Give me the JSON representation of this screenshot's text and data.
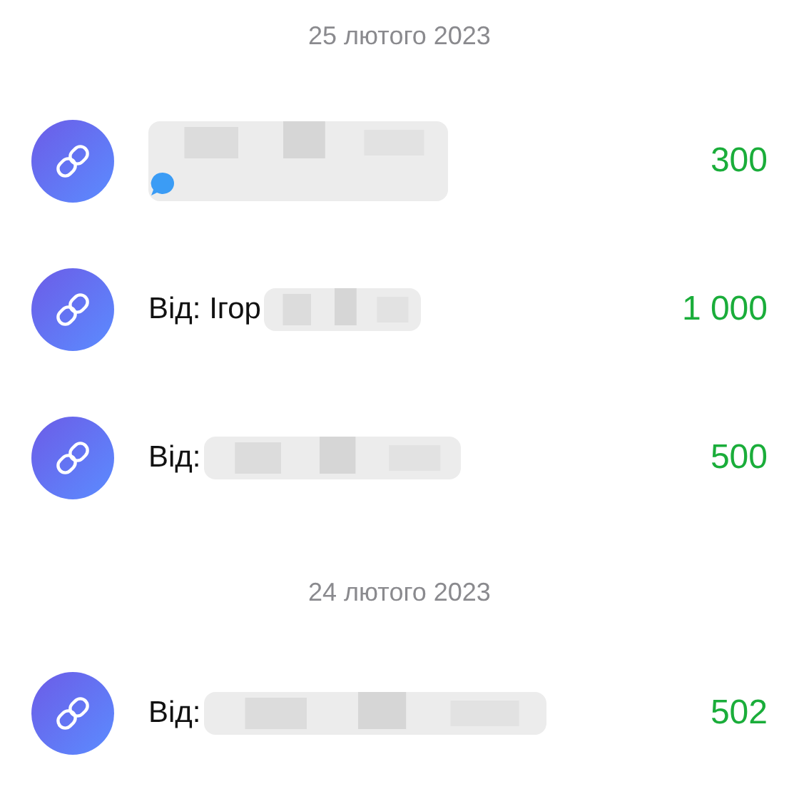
{
  "days": [
    {
      "date": "25 лютого 2023",
      "transfers": [
        {
          "kind": "with-note",
          "amount": "300"
        },
        {
          "kind": "plain",
          "sender": "Від: Ігор",
          "amount": "1 000"
        },
        {
          "kind": "plain",
          "sender": "Від:",
          "amount": "500"
        }
      ]
    },
    {
      "date": "24 лютого 2023",
      "transfers": [
        {
          "kind": "plain",
          "sender": "Від:",
          "amount": "502"
        }
      ]
    }
  ]
}
